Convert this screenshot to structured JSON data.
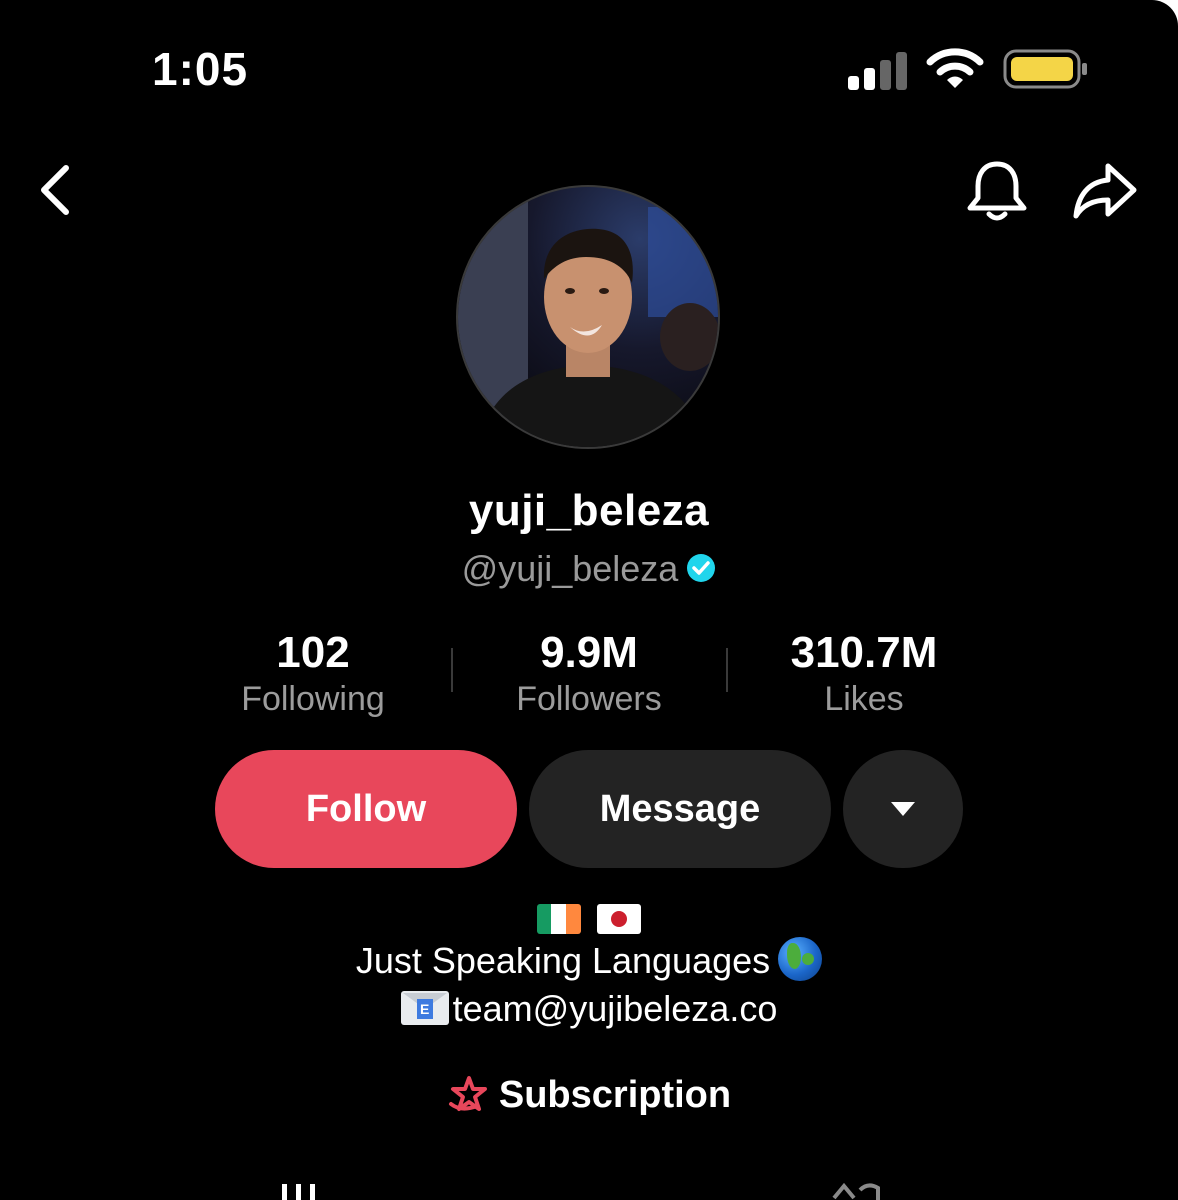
{
  "status_bar": {
    "time": "1:05"
  },
  "header": {
    "back_icon": "chevron-left-icon",
    "bell_icon": "bell-icon",
    "share_icon": "share-arrow-icon"
  },
  "profile": {
    "display_name": "yuji_beleza",
    "handle": "@yuji_beleza",
    "verified": true
  },
  "stats": [
    {
      "value": "102",
      "label": "Following"
    },
    {
      "value": "9.9M",
      "label": "Followers"
    },
    {
      "value": "310.7M",
      "label": "Likes"
    }
  ],
  "actions": {
    "follow_label": "Follow",
    "message_label": "Message",
    "more_icon": "triangle-down-icon"
  },
  "bio": {
    "flags": [
      "flag-ireland",
      "flag-japan"
    ],
    "line1": "Just Speaking Languages",
    "line2": "team@yujibeleza.co"
  },
  "subscription": {
    "label": "Subscription"
  },
  "colors": {
    "background": "#000000",
    "follow": "#e8475b",
    "secondary_button": "#232323",
    "muted_text": "#9c9c9c",
    "verified": "#20d5ec"
  }
}
